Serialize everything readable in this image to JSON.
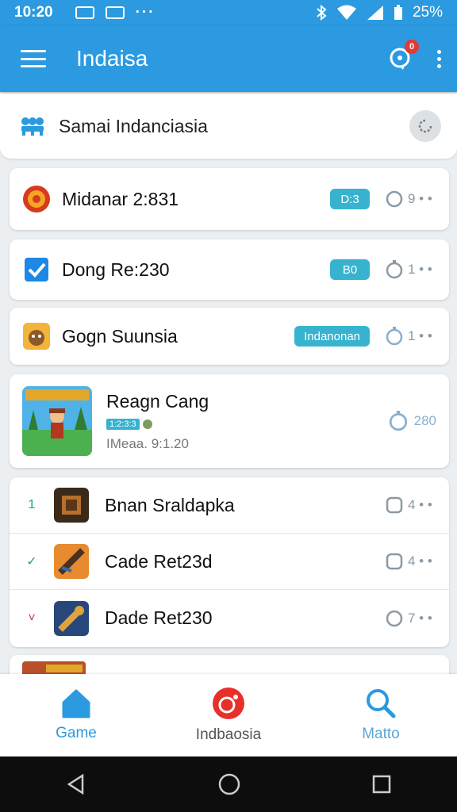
{
  "status_bar": {
    "time": "10:20",
    "battery": "25%"
  },
  "app_bar": {
    "title": "Indaisa",
    "notification_count": "0"
  },
  "search_card": {
    "label": "Samai Indanciasia"
  },
  "cards": [
    {
      "name": "Midanar 2:831",
      "pill": "D:3",
      "meta": "9 • •"
    },
    {
      "name": "Dong Re:230",
      "pill": "B0",
      "meta": "1 • •"
    },
    {
      "name": "Gogn Suunsia",
      "pill": "Indanonan",
      "meta": "1 • •"
    }
  ],
  "featured": {
    "title": "Reagn Cang",
    "tag": "1:2:3:3",
    "subtitle": "IMeaa. 9:1.20",
    "meta": "280"
  },
  "list": [
    {
      "mark": "1",
      "name": "Bnan Sraldapka",
      "meta": "4 • •"
    },
    {
      "mark": "✓",
      "name": "Cade Ret23d",
      "meta": "4 • •"
    },
    {
      "mark": "˅",
      "name": "Dade Ret230",
      "meta": "7 • •"
    }
  ],
  "bottom_nav": [
    {
      "label": "Game"
    },
    {
      "label": "Indbaosia"
    },
    {
      "label": "Matto"
    }
  ],
  "colors": {
    "primary": "#2b9ae0",
    "accent": "#37b3cf",
    "badge": "#e53935"
  }
}
